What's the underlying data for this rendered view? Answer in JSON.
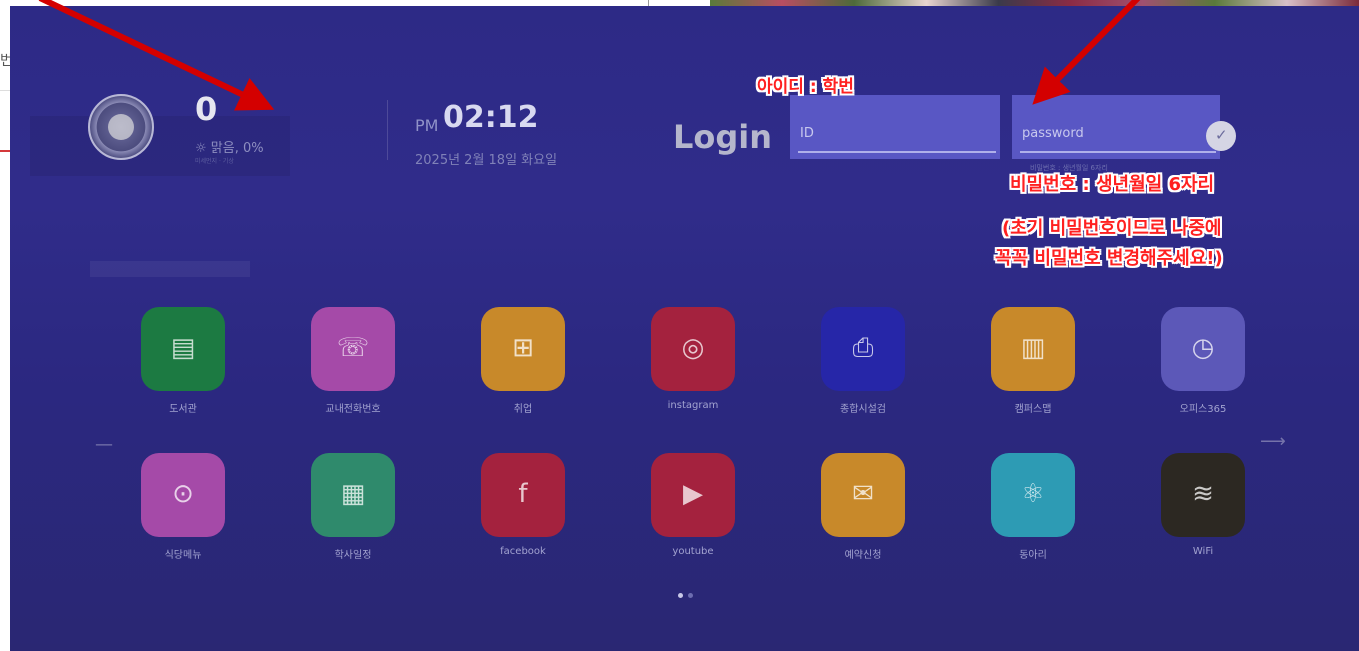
{
  "page": {
    "left_char": "번"
  },
  "kiosk": {
    "temperature": "0",
    "weather": "☼ 맑음, 0%",
    "weather_sub": "미세먼지 ·  기상",
    "ampm": "PM",
    "time": "02:12",
    "date": "2025년 2월 18일 화요일",
    "login_label": "Login",
    "id_placeholder": "ID",
    "password_placeholder": "password",
    "password_hint": "비밀번호 : 생년월일 6자리"
  },
  "annotations": {
    "id_note": "아이디 : 학번",
    "pw_note": "비밀번호 : 생년월일 6자리",
    "change_note_1": "(초기 비밀번호이므로 나중에",
    "change_note_2": "꼭꼭 비밀번호 변경해주세요!)",
    "arrow_color": "#d40000"
  },
  "apps_row1": [
    {
      "label": "도서관",
      "icon": "book-icon",
      "color": "#1c7a42"
    },
    {
      "label": "교내전화번호",
      "icon": "phone-icon",
      "color": "#a54aa8"
    },
    {
      "label": "취업",
      "icon": "briefcase-icon",
      "color": "#c8892a"
    },
    {
      "label": "instagram",
      "icon": "instagram-icon",
      "color": "#a4223e"
    },
    {
      "label": "종합시설검",
      "icon": "printer-icon",
      "color": "#2626a8"
    },
    {
      "label": "캠퍼스맵",
      "icon": "map-icon",
      "color": "#c8892a"
    },
    {
      "label": "오피스365",
      "icon": "gauge-icon",
      "color": "#5c58b8"
    }
  ],
  "apps_row2": [
    {
      "label": "식당메뉴",
      "icon": "dining-icon",
      "color": "#a54aa8"
    },
    {
      "label": "학사일정",
      "icon": "calendar-icon",
      "color": "#2f8a6c"
    },
    {
      "label": "facebook",
      "icon": "facebook-icon",
      "color": "#a4223e"
    },
    {
      "label": "youtube",
      "icon": "youtube-icon",
      "color": "#a4223e"
    },
    {
      "label": "예약신청",
      "icon": "mail-icon",
      "color": "#c8892a"
    },
    {
      "label": "동아리",
      "icon": "atom-icon",
      "color": "#2d9bb4"
    },
    {
      "label": "WiFi",
      "icon": "wifi-icon",
      "color": "#2c2822"
    }
  ],
  "pager": {
    "nav_right": "⟶",
    "nav_left": "—"
  }
}
